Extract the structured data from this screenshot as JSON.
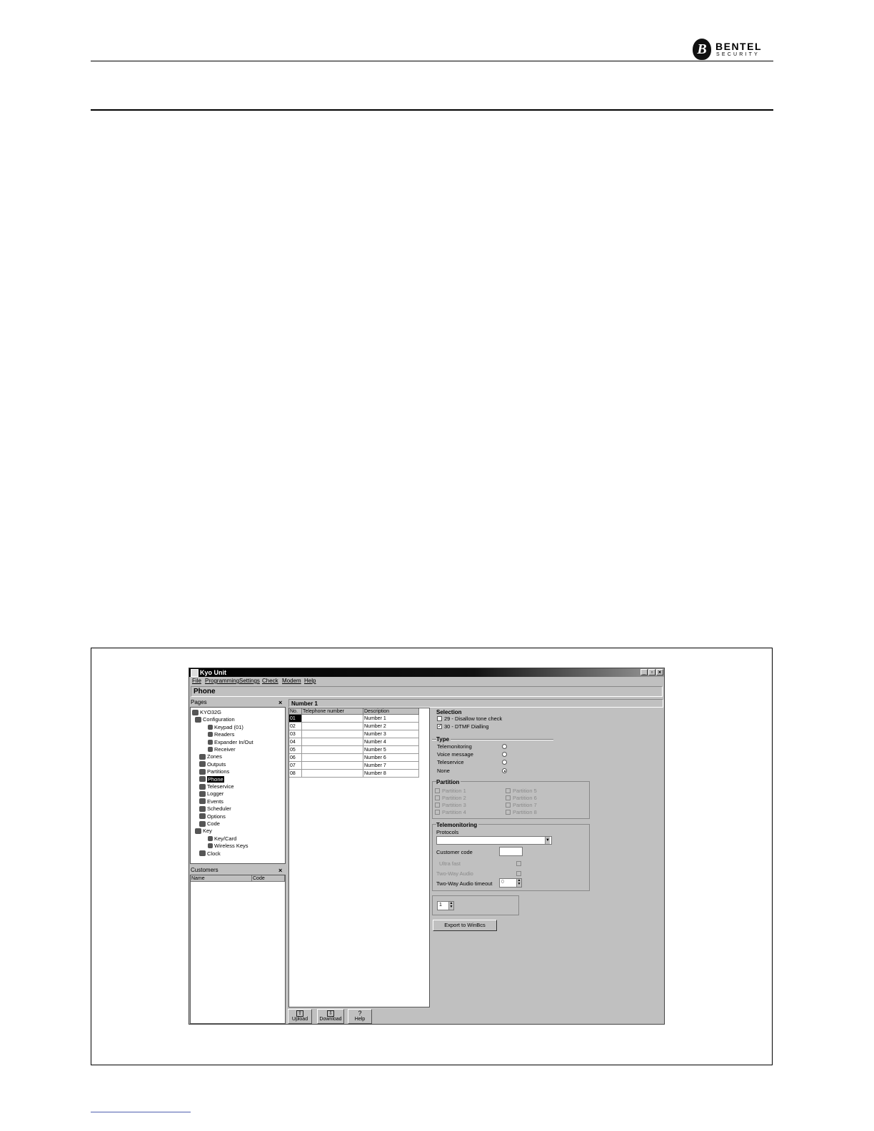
{
  "page": {
    "logo_name": "BENTEL",
    "logo_sub": "SECURITY"
  },
  "app": {
    "title": "Kyo Unit",
    "menu": [
      "File",
      "Programming",
      "Settings",
      "Check",
      "Modem",
      "Help"
    ],
    "header": "Phone",
    "pages_panel": {
      "title": "Pages",
      "tree": [
        {
          "label": "KYO32G",
          "selected": false
        },
        {
          "label": "Configuration",
          "selected": false
        },
        {
          "label": "Keypad (01)",
          "selected": false
        },
        {
          "label": "Readers",
          "selected": false
        },
        {
          "label": "Expander In/Out",
          "selected": false
        },
        {
          "label": "Receiver",
          "selected": false
        },
        {
          "label": "Zones",
          "selected": false
        },
        {
          "label": "Outputs",
          "selected": false
        },
        {
          "label": "Partitions",
          "selected": false
        },
        {
          "label": "Phone",
          "selected": true
        },
        {
          "label": "Teleservice",
          "selected": false
        },
        {
          "label": "Logger",
          "selected": false
        },
        {
          "label": "Events",
          "selected": false
        },
        {
          "label": "Scheduler",
          "selected": false
        },
        {
          "label": "Options",
          "selected": false
        },
        {
          "label": "Code",
          "selected": false
        },
        {
          "label": "Key",
          "selected": false
        },
        {
          "label": "Key/Card",
          "selected": false
        },
        {
          "label": "Wireless Keys",
          "selected": false
        },
        {
          "label": "Clock",
          "selected": false
        }
      ]
    },
    "customers_panel": {
      "title": "Customers",
      "columns": [
        "Name",
        "Code"
      ]
    },
    "number_panel": {
      "title": "Number 1",
      "columns": [
        "No.",
        "Telephone number",
        "Description"
      ],
      "rows": [
        {
          "no": "01",
          "tel": "",
          "desc": "Number 1"
        },
        {
          "no": "02",
          "tel": "",
          "desc": "Number 2"
        },
        {
          "no": "03",
          "tel": "",
          "desc": "Number 3"
        },
        {
          "no": "04",
          "tel": "",
          "desc": "Number 4"
        },
        {
          "no": "05",
          "tel": "",
          "desc": "Number 5"
        },
        {
          "no": "06",
          "tel": "",
          "desc": "Number 6"
        },
        {
          "no": "07",
          "tel": "",
          "desc": "Number 7"
        },
        {
          "no": "08",
          "tel": "",
          "desc": "Number 8"
        }
      ]
    },
    "selection": {
      "title": "Selection",
      "options": [
        {
          "label": "29 - Disallow tone check",
          "checked": false
        },
        {
          "label": "30 - DTMF Dialling",
          "checked": true
        }
      ]
    },
    "type": {
      "title": "Type",
      "options": [
        {
          "label": "Telemonitoring",
          "selected": false
        },
        {
          "label": "Voice message",
          "selected": false
        },
        {
          "label": "Teleservice",
          "selected": false
        },
        {
          "label": "None",
          "selected": true
        }
      ]
    },
    "partition": {
      "title": "Partition",
      "items": [
        "Partition 1",
        "Partition 5",
        "Partition 2",
        "Partition 6",
        "Partition 3",
        "Partition 7",
        "Partition 4",
        "Partition 8"
      ]
    },
    "telemonitoring": {
      "title": "Telemonitoring",
      "protocols_label": "Protocols",
      "protocols_value": "",
      "customer_code_label": "Customer code",
      "customer_code_value": "",
      "disabled_1": "Ultra fast",
      "disabled_2": "Two-Way Audio",
      "two_way_label": "Two-Way Audio timeout",
      "two_way_value": "0"
    },
    "repeat_value": "1",
    "export_button": "Export to WinBcs",
    "toolbar": [
      "Upload",
      "Download",
      "Help"
    ]
  }
}
